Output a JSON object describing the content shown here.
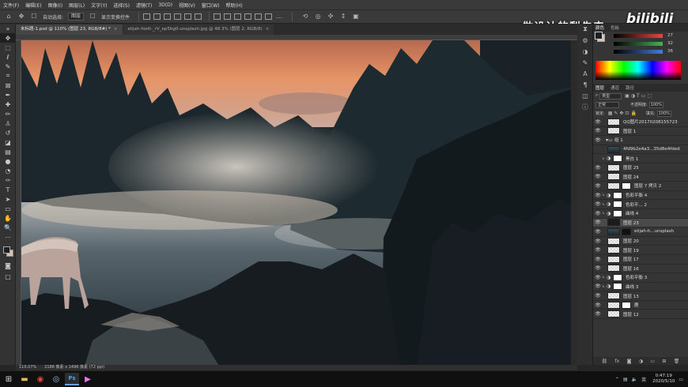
{
  "menu": [
    "文件(F)",
    "编辑(E)",
    "图像(I)",
    "图层(L)",
    "文字(Y)",
    "选择(S)",
    "滤镜(T)",
    "3D(D)",
    "视图(V)",
    "窗口(W)",
    "帮助(H)"
  ],
  "options_bar": {
    "auto_select_label": "自动选择:",
    "auto_select_value": "图层",
    "show_transform_label": "显示变换控件"
  },
  "tabs": [
    {
      "label": "未标题-1.psd @ 110% (图层 23, RGB/8#) *",
      "active": true
    },
    {
      "label": "elijah-hiett-_rV_ep5bg0-unsplash.jpg @ 48.3% (图层 2, RGB/8)",
      "active": false
    }
  ],
  "status": "110.07%　　2186 像素 x 1496 像素 (72 ppi)",
  "watermark": {
    "text": "做设计的梨先森",
    "logo": "bilibili"
  },
  "color_panel": {
    "tabs": [
      "颜色",
      "色板"
    ],
    "sliders": [
      {
        "label": "R",
        "value": "27",
        "color": "#e5493a"
      },
      {
        "label": "G",
        "value": "32",
        "color": "#4aae5a"
      },
      {
        "label": "B",
        "value": "36",
        "color": "#4a7ad8"
      }
    ]
  },
  "layers_panel": {
    "tabs": [
      "图层",
      "通道",
      "路径"
    ],
    "filter_kind": "类型",
    "blend_mode": "正常",
    "opacity_label": "不透明度:",
    "opacity": "100%",
    "lock_label": "锁定:",
    "fill_label": "填充:",
    "fill": "100%",
    "layers": [
      {
        "name": "QQ图片20170208155723",
        "thumb": "checker",
        "eye": true,
        "chain": false,
        "adj": false,
        "mask": null,
        "selected": false
      },
      {
        "name": "图层 1",
        "thumb": "checker",
        "eye": true,
        "chain": false,
        "adj": false,
        "mask": null,
        "selected": false
      },
      {
        "name": "组 1",
        "thumb": "folder",
        "eye": true,
        "chain": false,
        "adj": false,
        "mask": null,
        "selected": false
      },
      {
        "name": "4fd9b2e4a3...35d8e4fded",
        "thumb": "photo",
        "eye": false,
        "chain": false,
        "adj": false,
        "mask": null,
        "selected": false
      },
      {
        "name": "黑白 1",
        "thumb": "adj",
        "eye": false,
        "chain": true,
        "adj": true,
        "mask": "white",
        "selected": false
      },
      {
        "name": "图层 25",
        "thumb": "checker",
        "eye": true,
        "chain": false,
        "adj": false,
        "mask": null,
        "selected": false
      },
      {
        "name": "图层 24",
        "thumb": "checker",
        "eye": true,
        "chain": false,
        "adj": false,
        "mask": null,
        "selected": false
      },
      {
        "name": "图层 7 拷贝 2",
        "thumb": "checker",
        "eye": true,
        "chain": false,
        "adj": false,
        "mask": "white",
        "selected": false
      },
      {
        "name": "色彩平衡 4",
        "thumb": "adj",
        "eye": true,
        "chain": true,
        "adj": true,
        "mask": "white",
        "selected": false
      },
      {
        "name": "色彩平... 2",
        "thumb": "adj",
        "eye": true,
        "chain": true,
        "adj": true,
        "mask": "white",
        "selected": false
      },
      {
        "name": "曲线 4",
        "thumb": "adj",
        "eye": true,
        "chain": true,
        "adj": true,
        "mask": "white",
        "selected": false
      },
      {
        "name": "图层 23",
        "thumb": "dark",
        "eye": true,
        "chain": false,
        "adj": false,
        "mask": null,
        "selected": true
      },
      {
        "name": "elijah-h...unsplash",
        "thumb": "photo",
        "eye": true,
        "chain": false,
        "adj": false,
        "mask": "dark",
        "selected": false
      },
      {
        "name": "图层 20",
        "thumb": "checker",
        "eye": true,
        "chain": false,
        "adj": false,
        "mask": null,
        "selected": false
      },
      {
        "name": "图层 19",
        "thumb": "checker",
        "eye": true,
        "chain": false,
        "adj": false,
        "mask": null,
        "selected": false
      },
      {
        "name": "图层 17",
        "thumb": "checker",
        "eye": true,
        "chain": false,
        "adj": false,
        "mask": null,
        "selected": false
      },
      {
        "name": "图层 16",
        "thumb": "checker",
        "eye": true,
        "chain": false,
        "adj": false,
        "mask": null,
        "selected": false
      },
      {
        "name": "色彩平衡 3",
        "thumb": "adj",
        "eye": true,
        "chain": true,
        "adj": true,
        "mask": "white",
        "selected": false
      },
      {
        "name": "曲线 3",
        "thumb": "adj",
        "eye": true,
        "chain": true,
        "adj": true,
        "mask": "white",
        "selected": false
      },
      {
        "name": "图层 13",
        "thumb": "checker",
        "eye": true,
        "chain": false,
        "adj": false,
        "mask": null,
        "selected": false
      },
      {
        "name": "鹿",
        "thumb": "checker",
        "eye": true,
        "chain": false,
        "adj": false,
        "mask": "white",
        "selected": false
      },
      {
        "name": "图层 12",
        "thumb": "checker",
        "eye": true,
        "chain": false,
        "adj": false,
        "mask": null,
        "selected": false
      }
    ]
  },
  "taskbar": {
    "apps": [
      "windows-logo-icon",
      "file-explorer-icon",
      "chrome-icon",
      "ps-alt-icon",
      "photoshop-icon",
      "pr-icon"
    ],
    "ime": "英",
    "time": "0:47:19",
    "date": "2020/5/10"
  },
  "colors": {
    "accent": "#2d8ceb",
    "panel_bg": "#353535",
    "app_bg": "#262626"
  }
}
